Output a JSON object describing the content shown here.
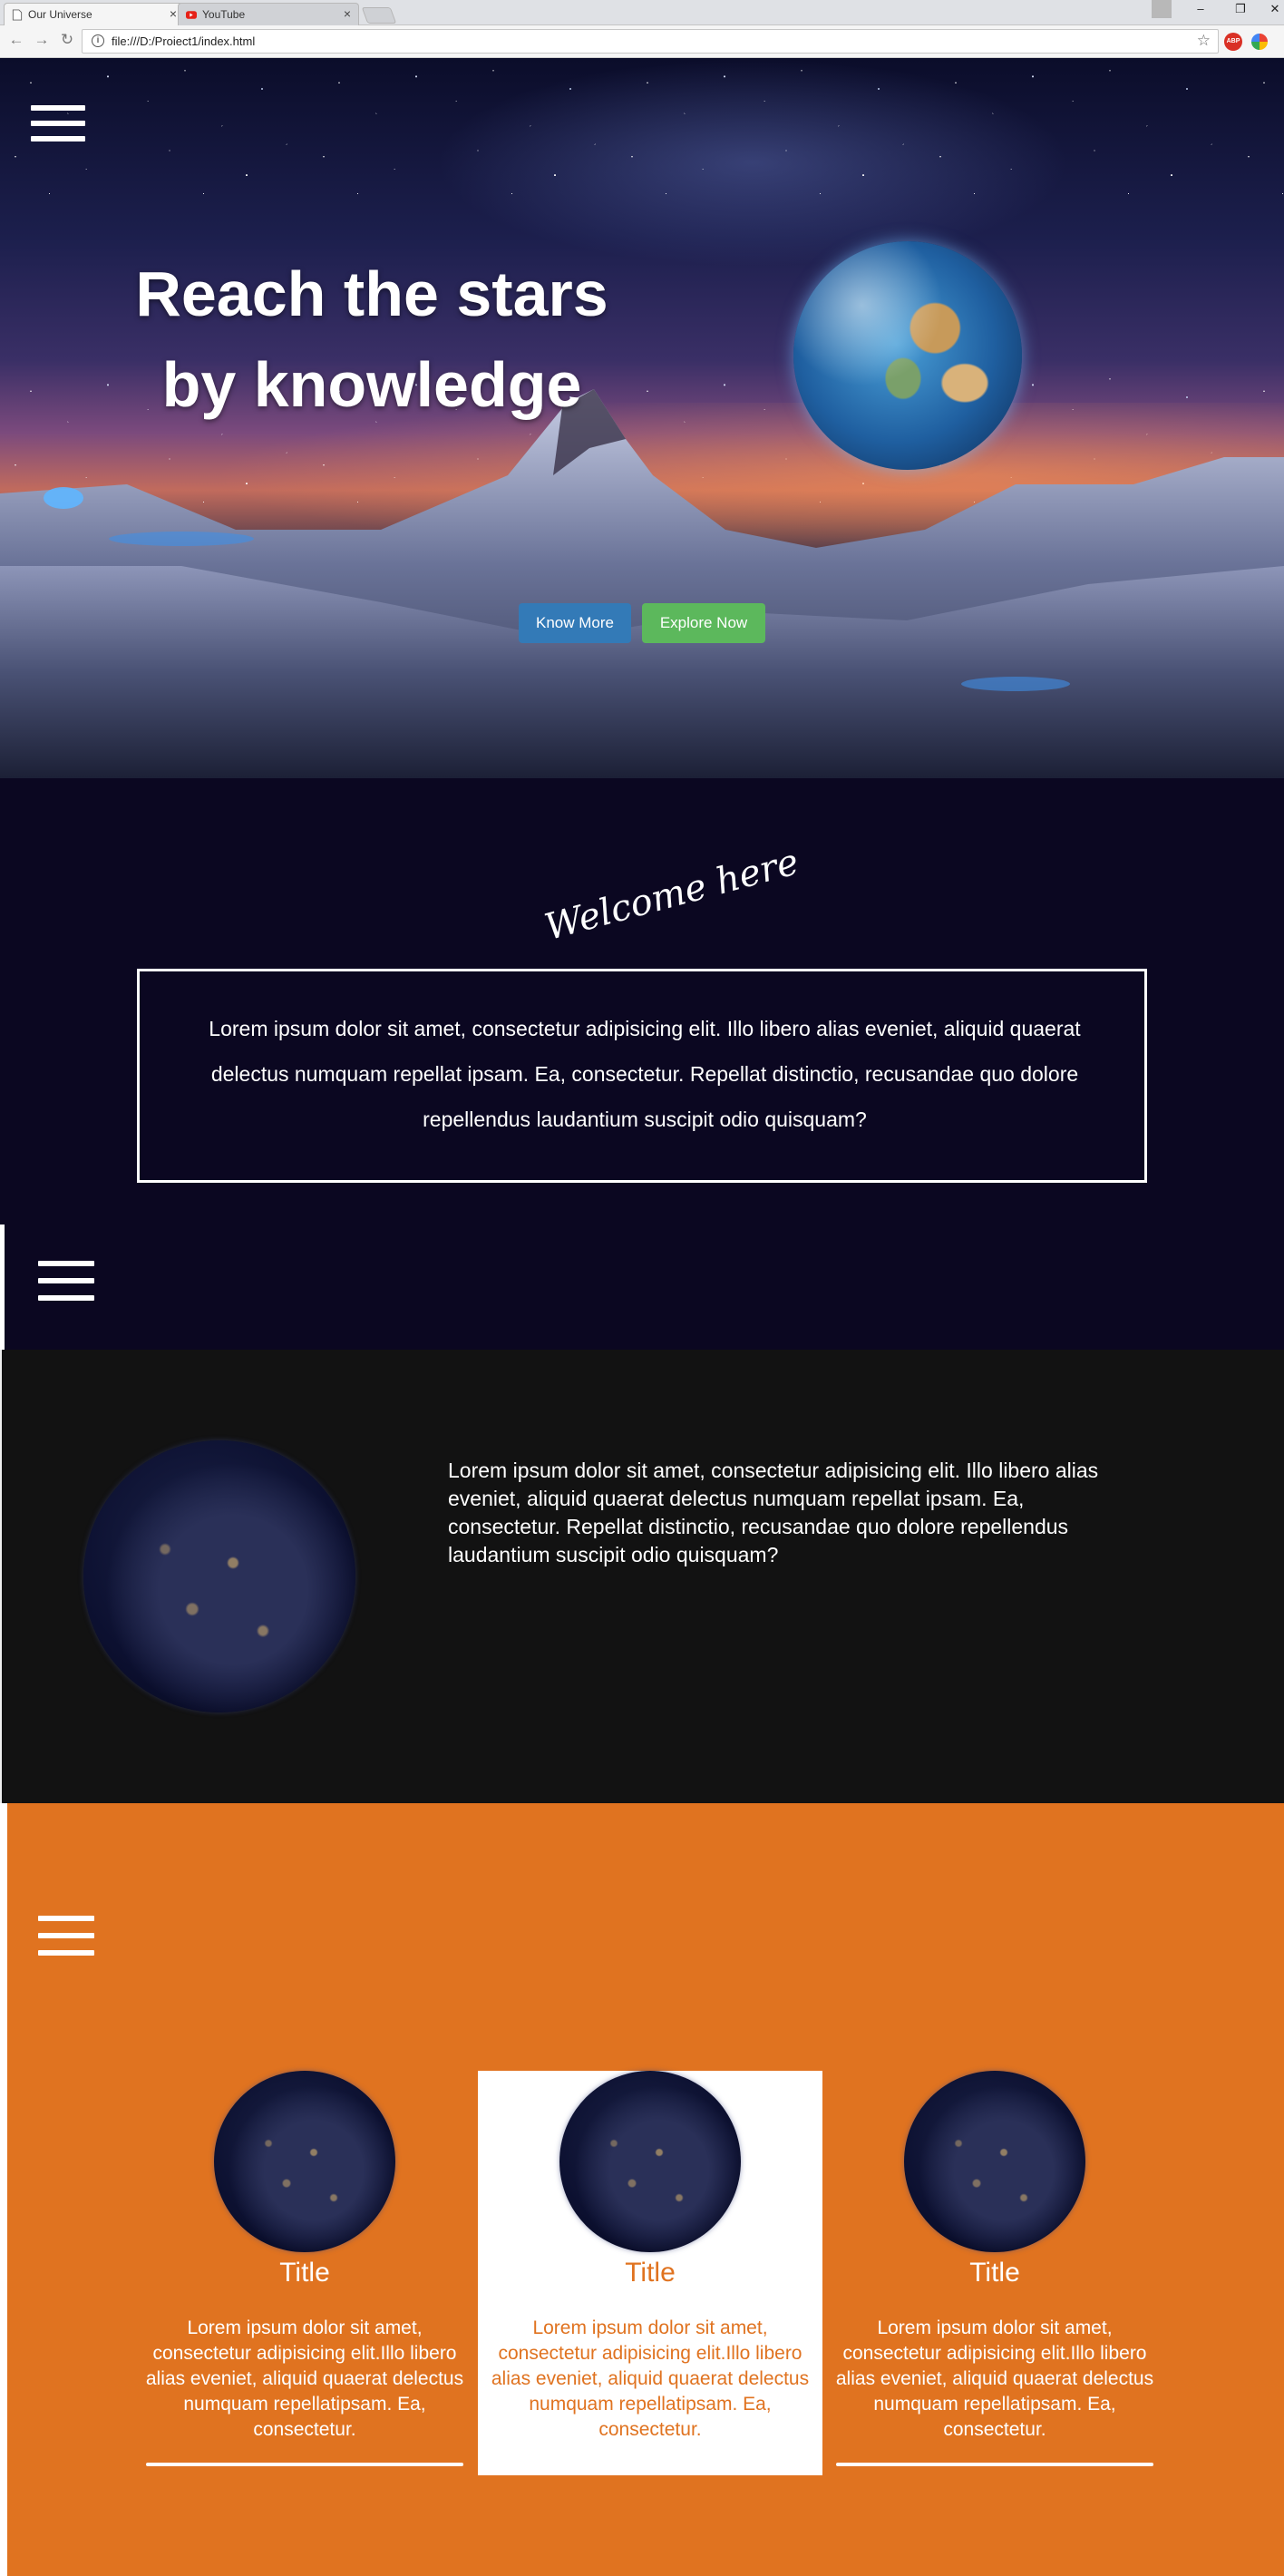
{
  "browser": {
    "tabs": [
      {
        "title": "Our Universe",
        "active": true
      },
      {
        "title": "YouTube",
        "active": false
      }
    ],
    "url": "file:///D:/Proiect1/index.html",
    "extension_abp": "ABP"
  },
  "hero": {
    "title_line1": "Reach the stars",
    "title_line2": "by knowledge",
    "buttons": {
      "know_more": "Know More",
      "explore_now": "Explore Now"
    }
  },
  "welcome": {
    "script_heading": "Welcome here",
    "text": "Lorem ipsum dolor sit amet, consectetur adipisicing elit. Illo libero alias eveniet, aliquid quaerat delectus numquam repellat ipsam. Ea, consectetur. Repellat distinctio, recusandae quo dolore repellendus laudantium suscipit odio quisquam?"
  },
  "about": {
    "text": "Lorem ipsum dolor sit amet, consectetur adipisicing elit. Illo libero alias eveniet, aliquid quaerat delectus numquam repellat ipsam. Ea, consectetur. Repellat distinctio, recusandae quo dolore repellendus laudantium suscipit odio quisquam?"
  },
  "cards": [
    {
      "title": "Title",
      "text": "Lorem ipsum dolor sit amet, consectetur adipisicing elit.Illo libero alias eveniet, aliquid quaerat delectus numquam repellatipsam. Ea, consectetur."
    },
    {
      "title": "Title",
      "text": "Lorem ipsum dolor sit amet, consectetur adipisicing elit.Illo libero alias eveniet, aliquid quaerat delectus numquam repellatipsam. Ea, consectetur."
    },
    {
      "title": "Title",
      "text": "Lorem ipsum dolor sit amet, consectetur adipisicing elit.Illo libero alias eveniet, aliquid quaerat delectus numquam repellatipsam. Ea, consectetur."
    }
  ],
  "colors": {
    "welcome_bg": "#0b0721",
    "dark_bg": "#121212",
    "orange_bg": "#e07320",
    "btn_primary": "#337ab7",
    "btn_success": "#5cb85c"
  },
  "icons": [
    "page-icon",
    "youtube-icon",
    "close-icon",
    "back-icon",
    "forward-icon",
    "reload-icon",
    "info-icon",
    "star-icon",
    "menu-icon",
    "profile-icon"
  ]
}
